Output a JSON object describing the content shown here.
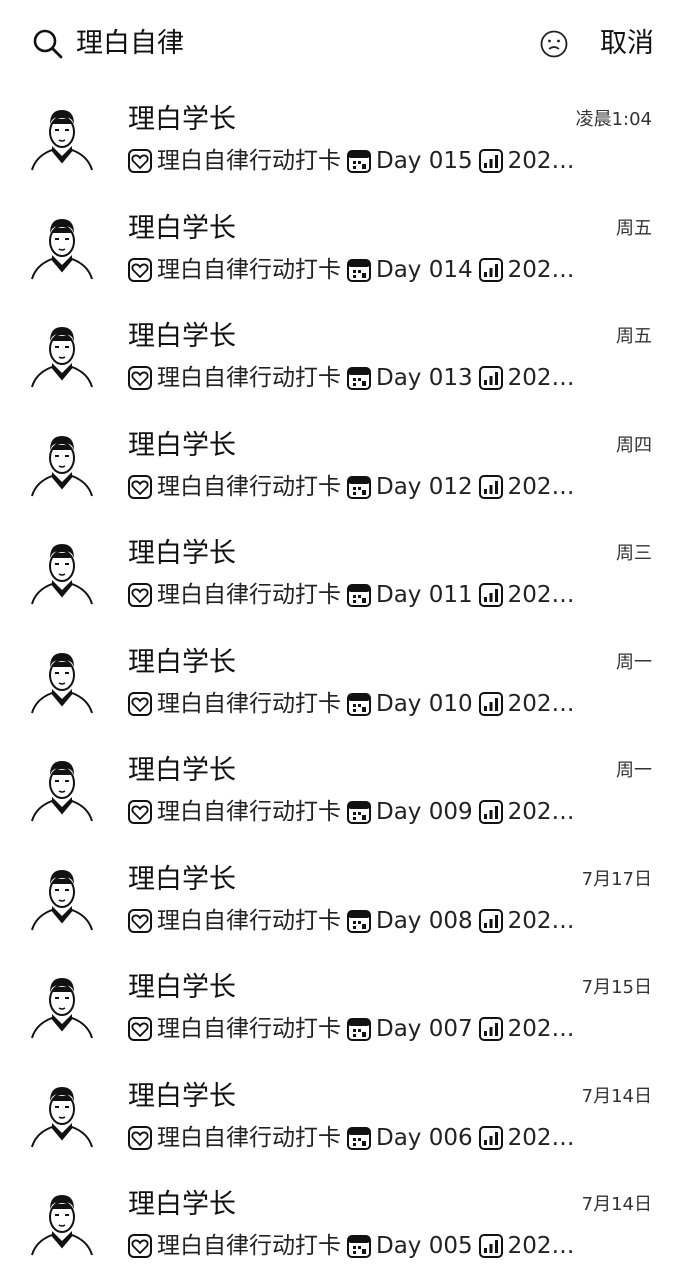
{
  "search": {
    "query": "理白自律",
    "cancel_label": "取消"
  },
  "results": [
    {
      "name": "理白学长",
      "time": "凌晨1:04",
      "text": "理白自律行动打卡",
      "day": "Day 015",
      "date_text": "2022..."
    },
    {
      "name": "理白学长",
      "time": "周五",
      "text": "理白自律行动打卡",
      "day": "Day 014",
      "date_text": "2022..."
    },
    {
      "name": "理白学长",
      "time": "周五",
      "text": "理白自律行动打卡",
      "day": "Day 013",
      "date_text": "2022..."
    },
    {
      "name": "理白学长",
      "time": "周四",
      "text": "理白自律行动打卡",
      "day": "Day 012",
      "date_text": "2022..."
    },
    {
      "name": "理白学长",
      "time": "周三",
      "text": "理白自律行动打卡",
      "day": "Day 011",
      "date_text": "2022..."
    },
    {
      "name": "理白学长",
      "time": "周一",
      "text": "理白自律行动打卡",
      "day": "Day 010",
      "date_text": "2022..."
    },
    {
      "name": "理白学长",
      "time": "周一",
      "text": "理白自律行动打卡",
      "day": "Day 009",
      "date_text": "2022..."
    },
    {
      "name": "理白学长",
      "time": "7月17日",
      "text": "理白自律行动打卡",
      "day": "Day 008",
      "date_text": "2022..."
    },
    {
      "name": "理白学长",
      "time": "7月15日",
      "text": "理白自律行动打卡",
      "day": "Day 007",
      "date_text": "2022..."
    },
    {
      "name": "理白学长",
      "time": "7月14日",
      "text": "理白自律行动打卡",
      "day": "Day 006",
      "date_text": "2022..."
    },
    {
      "name": "理白学长",
      "time": "7月14日",
      "text": "理白自律行动打卡",
      "day": "Day 005",
      "date_text": "2022..."
    }
  ],
  "icons": {
    "search": "search-icon",
    "emoji": "emoji-icon",
    "avatar": "avatar-icon",
    "heart": "heart-emoji-icon",
    "calendar": "calendar-emoji-icon",
    "chart": "chart-emoji-icon"
  }
}
